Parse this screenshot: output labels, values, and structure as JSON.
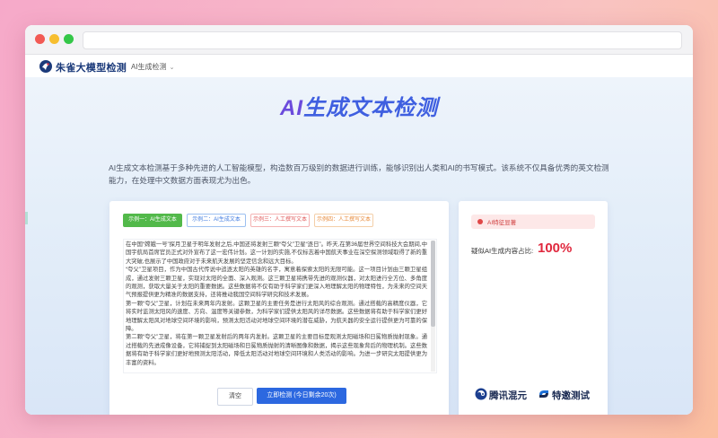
{
  "window": {
    "traffic_lights": [
      "close",
      "minimize",
      "maximize"
    ]
  },
  "header": {
    "logo_text": "朱雀大模型检测",
    "nav_item": "AI生成检测",
    "nav_caret": "⌄"
  },
  "hero": {
    "title_ai": "AI",
    "title_rest": "生成文本检测",
    "description": "AI生成文本检测基于多种先进的人工智能模型，构造数百万级别的数据进行训练，能够识别出人类和AI的书写模式。该系统不仅具备优秀的英文检测能力，在处理中文数据方面表现尤为出色。"
  },
  "tabs": [
    {
      "label": "示例一：AI生成文本"
    },
    {
      "label": "示例二：AI生成文本"
    },
    {
      "label": "示例三：人工撰写文本"
    },
    {
      "label": "示例四：人工撰写文本"
    }
  ],
  "article": {
    "paragraphs": [
      "在中国“嫦娥一号”探月卫星于明年发射之后,中国还将发射三颗“夸父”卫星“逐日”。昨天,在第36届世界空间科技大会期间,中国宇航局首席官员正式对外宣布了这一宏伟计划。这一计划的实施,不仅标志着中国航天事业在深空探测领域取得了新的重大突破,也展示了中国政府对于未来航天发展的坚定信念和远大目标。",
      "“夸父”卫星项目，作为中国古代传说中追逐太阳的英雄的名字，寓意着探索太阳的无限可能。这一项目计划由三颗卫星组成，通过发射三颗卫星，实现对太阳的全面、深入观测。这三颗卫星将携带先进的观测仪器，对太阳进行全方位、多角度的观测，获取大量关于太阳的重要数据。这些数据将不仅有助于科学家们更深入地理解太阳的物理特性，为未来的空间天气预报提供更为精准的数据支持，还将推动我国空间科学研究和技术发展。",
      "第一颗“夸父”卫星，计划在未来两年内发射。这颗卫星的主要任务是进行太阳风的综合观测。通过搭载的高精度仪器，它将实时监测太阳风的速度、方向、温度等关键参数，为科学家们提供太阳风的详尽数据。这些数据将有助于科学家们更好地理解太阳风对地球空间环境的影响，预测太阳活动对地球空间环境的潜在威胁，为航天器的安全运行提供更为可靠的保障。",
      "第二颗“夸父”卫星，将在第一颗卫星发射后的两年内发射。这颗卫星的主要目标是观测太阳磁场和日冕物质抛射现象。通过搭载的先进成像设备，它将捕捉到太阳磁场和日冕物质抛射的清晰图像和数据，揭示这些现象背后的物理机制。这些数据将有助于科学家们更好地预测太阳活动，降低太阳活动对地球空间环境和人类活动的影响。为进一步研究太阳提供更为丰富的资料。"
    ]
  },
  "actions": {
    "clear_label": "清空",
    "detect_label": "立即检测 (今日剩余20次)"
  },
  "result": {
    "tag_text": "AI特征显著",
    "label": "疑似AI生成内容占比:",
    "value": "100%",
    "accent_color": "#e0283e"
  },
  "brands": {
    "brand1": "腾讯混元",
    "brand2": "特邀测试"
  },
  "colors": {
    "primary": "#2c68e0",
    "title": "#3f5fe0",
    "tab1": "#52b94a",
    "tab2": "#3f7be0",
    "tab3": "#e05a5a",
    "tab4": "#e88b3b"
  }
}
